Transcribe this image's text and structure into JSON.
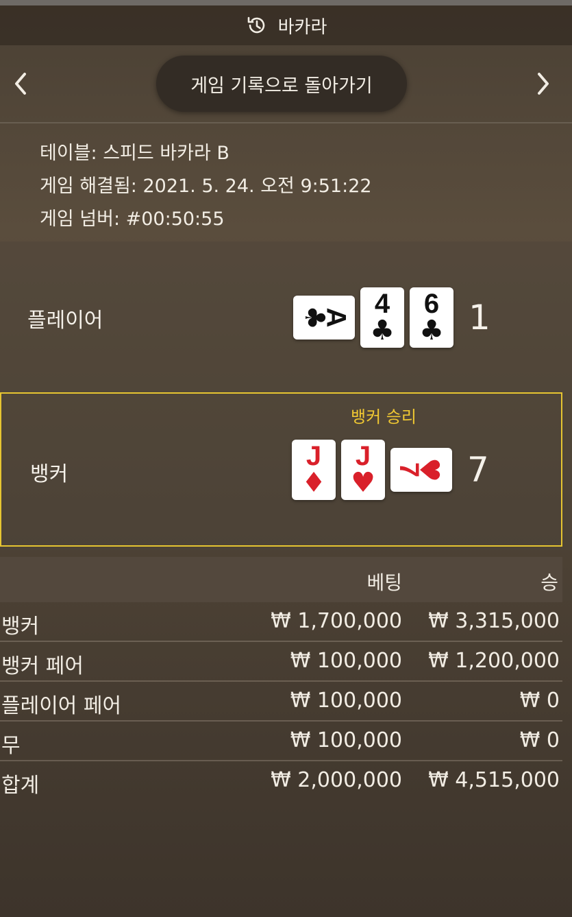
{
  "header": {
    "title": "바카라",
    "icon": "history-icon"
  },
  "nav": {
    "back_label": "게임 기록으로 돌아가기",
    "prev_icon": "chevron-left-icon",
    "next_icon": "chevron-right-icon"
  },
  "info": {
    "table": "테이블: 스피드 바카라 B",
    "resolved": "게임 해결됨: 2021. 5. 24. 오전 9:51:22",
    "number": "게임 넘버: #00:50:55"
  },
  "player": {
    "label": "플레이어",
    "score": "1",
    "cards": [
      {
        "rank": "A",
        "suit": "♣",
        "color": "#111111",
        "orientation": "horizontal"
      },
      {
        "rank": "4",
        "suit": "♣",
        "color": "#111111",
        "orientation": "vertical"
      },
      {
        "rank": "6",
        "suit": "♣",
        "color": "#111111",
        "orientation": "vertical"
      }
    ]
  },
  "banker": {
    "label": "뱅커",
    "win_label": "뱅커 승리",
    "score": "7",
    "accent_color": "#e6c531",
    "cards": [
      {
        "rank": "J",
        "suit": "♦",
        "color": "#d9202a",
        "orientation": "vertical"
      },
      {
        "rank": "J",
        "suit": "♥",
        "color": "#d9202a",
        "orientation": "vertical"
      },
      {
        "rank": "7",
        "suit": "♥",
        "color": "#d9202a",
        "orientation": "horizontal"
      }
    ]
  },
  "bets": {
    "headers": {
      "bet": "베팅",
      "win": "승"
    },
    "rows": [
      {
        "name": "뱅커",
        "bet": "₩ 1,700,000",
        "win": "₩ 3,315,000"
      },
      {
        "name": "뱅커 페어",
        "bet": "₩ 100,000",
        "win": "₩ 1,200,000"
      },
      {
        "name": "플레이어 페어",
        "bet": "₩ 100,000",
        "win": "₩ 0"
      },
      {
        "name": "무",
        "bet": "₩ 100,000",
        "win": "₩ 0"
      },
      {
        "name": "합계",
        "bet": "₩ 2,000,000",
        "win": "₩ 4,515,000"
      }
    ]
  }
}
